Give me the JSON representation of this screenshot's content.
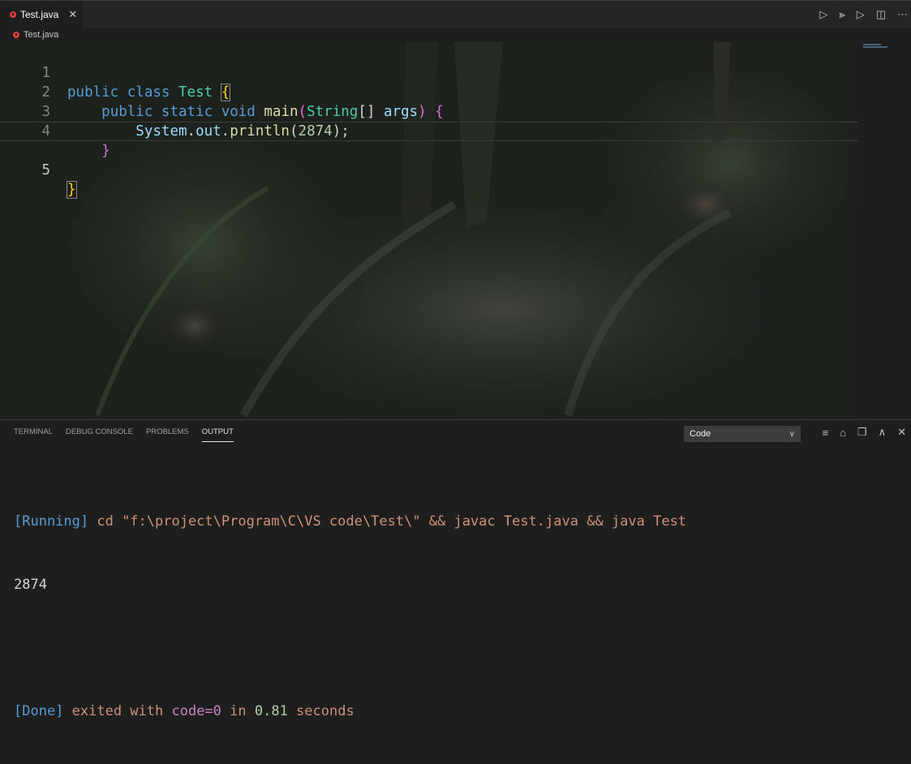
{
  "tab": {
    "label": "Test.java",
    "close_glyph": "✕"
  },
  "tab_actions": [
    {
      "name": "run-code-icon",
      "glyph": "▷"
    },
    {
      "name": "debug-run-icon",
      "glyph": "⪢"
    },
    {
      "name": "run-java-icon",
      "glyph": "▷"
    },
    {
      "name": "split-editor-icon",
      "glyph": "◫"
    },
    {
      "name": "more-actions-icon",
      "glyph": "⋯"
    }
  ],
  "breadcrumb": {
    "file": "Test.java"
  },
  "editor": {
    "line_numbers": [
      "1",
      "2",
      "3",
      "4",
      "5"
    ],
    "line1": {
      "kw1": "public",
      "kw2": "class",
      "name": "Test",
      "brace": "{"
    },
    "line2": {
      "kw1": "public",
      "kw2": "static",
      "kw3": "void",
      "fn": "main",
      "paren_open": "(",
      "type": "String",
      "arr": "[]",
      "arg": "args",
      "paren_close": ")",
      "brace": "{"
    },
    "line3": {
      "obj": "System",
      "dot1": ".",
      "field": "out",
      "dot2": ".",
      "fn": "println",
      "paren_open": "(",
      "num": "2874",
      "rest": ");"
    },
    "line4": {
      "brace": "}"
    },
    "line5": {
      "brace": "}"
    }
  },
  "panel": {
    "tabs": [
      "TERMINAL",
      "DEBUG CONSOLE",
      "PROBLEMS",
      "OUTPUT"
    ],
    "active_tab": "OUTPUT",
    "select_value": "Code",
    "actions": [
      {
        "name": "clear-output-icon",
        "glyph": "≡"
      },
      {
        "name": "lock-scroll-icon",
        "glyph": "⌂"
      },
      {
        "name": "copy-icon",
        "glyph": "❐"
      },
      {
        "name": "maximize-panel-icon",
        "glyph": "∧"
      },
      {
        "name": "close-panel-icon",
        "glyph": "✕"
      }
    ]
  },
  "output": {
    "running_tag": "[Running]",
    "running_cmd": " cd \"f:\\project\\Program\\C\\VS code\\Test\\\" && javac Test.java && java Test",
    "result": "2874",
    "done_tag": "[Done]",
    "done_pre": " exited with ",
    "done_code": "code=0",
    "done_mid": " in ",
    "done_time": "0.81",
    "done_post": " seconds"
  },
  "colors": {
    "java_icon": "#e03b3b",
    "keyword": "#569cd6",
    "type": "#4ec9b0",
    "function": "#dcdcaa",
    "variable": "#9cdcfe",
    "number": "#b5cea8",
    "bracket_level1": "#ffd700",
    "bracket_level2": "#da70d6",
    "output_string": "#ce9178"
  }
}
